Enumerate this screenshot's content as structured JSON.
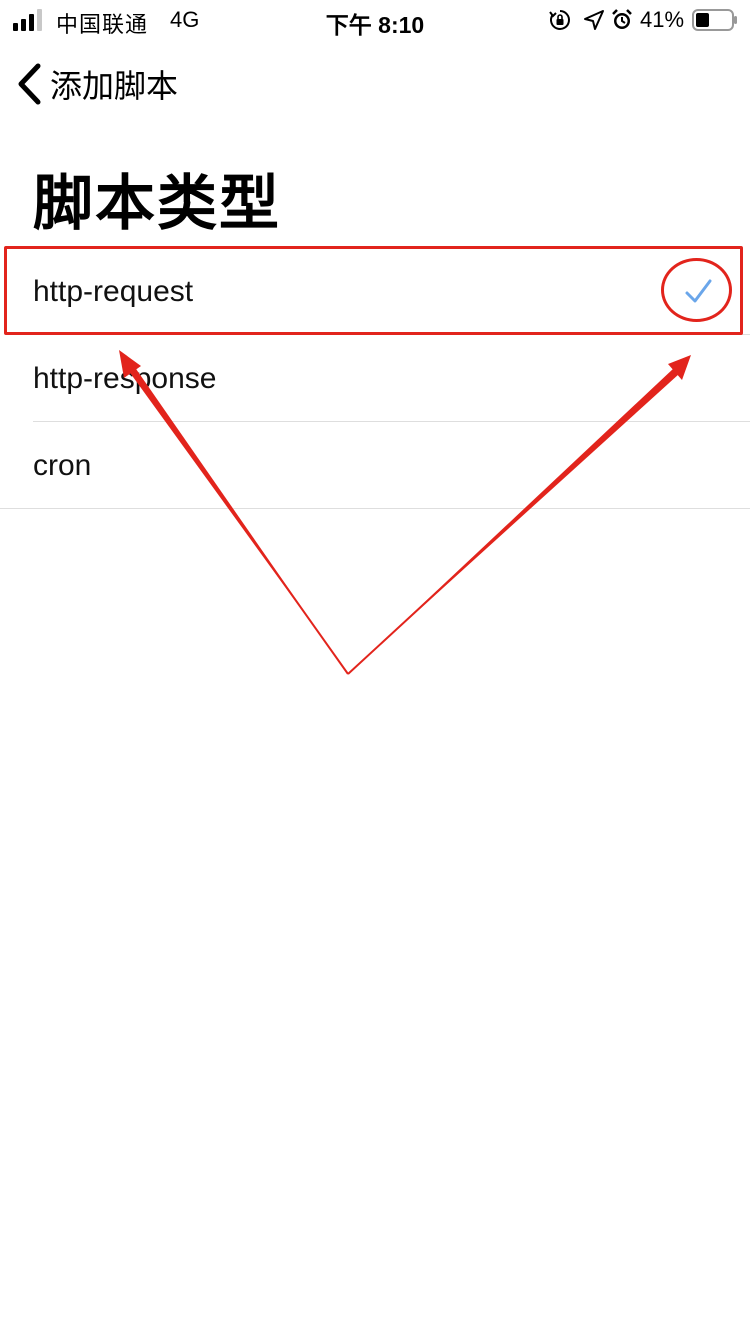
{
  "status_bar": {
    "carrier": "中国联通",
    "network": "4G",
    "time": "下午 8:10",
    "battery_percent": "41%",
    "icons": [
      "signal-icon",
      "rotation-lock-icon",
      "location-icon",
      "alarm-icon",
      "battery-icon"
    ]
  },
  "nav": {
    "back_label": "添加脚本",
    "back_icon": "chevron-left-icon"
  },
  "page": {
    "title": "脚本类型"
  },
  "script_types": [
    {
      "label": "http-request",
      "selected": true
    },
    {
      "label": "http-response",
      "selected": false
    },
    {
      "label": "cron",
      "selected": false
    }
  ],
  "colors": {
    "accent": "#3478f6",
    "checkmark": "#6aa6ea",
    "annotation": "#e2241c",
    "separator": "#dedede"
  }
}
